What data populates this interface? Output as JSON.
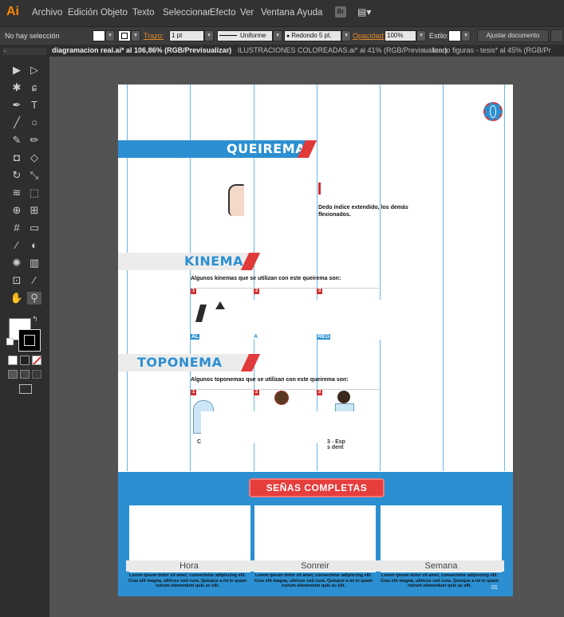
{
  "app": {
    "logo": "Ai"
  },
  "menu": [
    "Archivo",
    "Edición",
    "Objeto",
    "Texto",
    "Seleccionar",
    "Efecto",
    "Ver",
    "Ventana",
    "Ayuda"
  ],
  "menu_extra": {
    "bridge": "Br",
    "workspace": "▤▾"
  },
  "control": {
    "selection": "No hay selección",
    "stroke_label": "Trazo:",
    "stroke_value": "1 pt",
    "profile": "Uniforme",
    "brush": "Redondo 5 pt.",
    "opacity_label": "Opacidad:",
    "opacity_value": "100%",
    "style_label": "Estilo:",
    "align_button": "Ajustar documento"
  },
  "tabs": [
    {
      "label": "diagramacion real.ai* al 106,86% (RGB/Previsualizar)",
      "active": true
    },
    {
      "label": "ILUSTRACIONES COLOREADAS.ai* al 41% (RGB/Previsualizar)",
      "active": false
    },
    {
      "label": "fondo figuras - tesis* al 45% (RGB/Pr",
      "active": false
    }
  ],
  "tab_close": "×",
  "tools": [
    "select-icon",
    "direct-select-icon",
    "magic-wand-icon",
    "lasso-icon",
    "pen-icon",
    "type-icon",
    "line-icon",
    "ellipse-icon",
    "brush-icon",
    "pencil-icon",
    "blob-brush-icon",
    "eraser-icon",
    "rotate-icon",
    "scale-icon",
    "width-icon",
    "free-transform-icon",
    "shape-builder-icon",
    "perspective-icon",
    "mesh-icon",
    "gradient-icon",
    "eyedropper-icon",
    "blend-icon",
    "symbol-sprayer-icon",
    "column-graph-icon",
    "artboard-icon",
    "slice-icon",
    "hand-icon",
    "zoom-icon"
  ],
  "doc": {
    "section1_title": "QUEIREMA",
    "section1_desc": "Dedo índice extendido, los demás flexionados.",
    "section2_title": "KINEMA",
    "section2_intro": "Algunos kinemas que se utilizan con este queirema son:",
    "section2_captions": [
      "AL",
      "A",
      "REG"
    ],
    "section3_title": "TOPONEMA",
    "section3_intro": "Algunos toponemas que se utilizan con este queirema son:",
    "section3_captions": [
      "C",
      "3 - Esp",
      "s dent"
    ],
    "badges": [
      "1",
      "2",
      "3"
    ],
    "complete_signs": "SEÑAS COMPLETAS",
    "words": [
      "Hora",
      "Sonreir",
      "Semana"
    ],
    "lorem": "Lorem ipsum dolor sit amet, consectetur adipiscing elit. Cras elit magna, ultrices sed cura. Quisque a mi in quam rutrum elementum quis ac elit.",
    "page_number": "01"
  },
  "colors": {
    "accent_blue": "#2b8fd1",
    "accent_red": "#e03a3a",
    "app_orange": "#ff8a00"
  }
}
